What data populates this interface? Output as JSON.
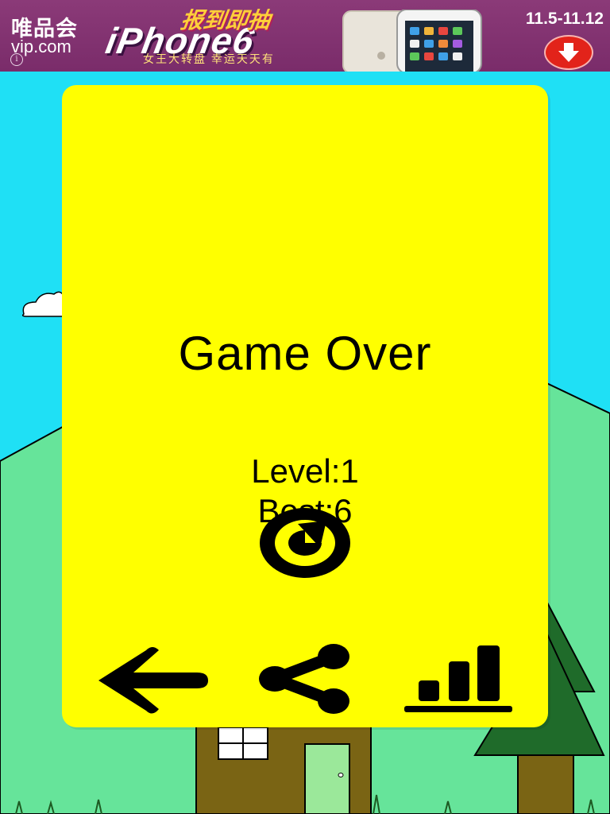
{
  "ad": {
    "brand_cn": "唯品会",
    "brand_en": "vip.com",
    "headline": "报到即抽",
    "product": "iPhone6",
    "subtitle": "女王大转盘 幸运天天有",
    "dates": "11.5-11.12",
    "info_icon": "info-icon",
    "download_icon": "download-arrow-icon"
  },
  "game_over": {
    "title": "Game Over",
    "level": "Level:1",
    "best": "Best:6"
  },
  "buttons": {
    "replay": "replay-icon",
    "back": "back-arrow-icon",
    "share": "share-icon",
    "leaderboard": "leaderboard-icon"
  },
  "colors": {
    "sky": "#1fe0f5",
    "panel": "#ffff00",
    "hills": "#66e49a",
    "ad_background": "#7a2c6a"
  }
}
